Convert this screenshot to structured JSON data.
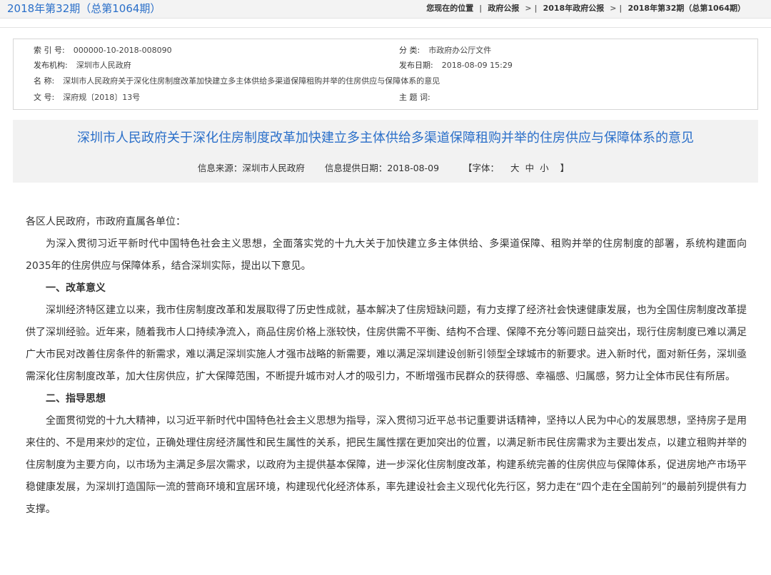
{
  "header": {
    "issue_title": "2018年第32期（总第1064期）",
    "breadcrumb_lead": "您现在的位置",
    "breadcrumb": [
      "政府公报",
      "2018年政府公报",
      "2018年第32期（总第1064期）"
    ],
    "separator": ">"
  },
  "meta": {
    "index_label": "索 引 号:",
    "index_value": "000000-10-2018-008090",
    "category_label": "分 类:",
    "category_value": "市政府办公厅文件",
    "publisher_label": "发布机构:",
    "publisher_value": "深圳市人民政府",
    "date_label": "发布日期:",
    "date_value": "2018-08-09 15:29",
    "name_label": "名 称:",
    "name_value": "深圳市人民政府关于深化住房制度改革加快建立多主体供给多渠道保障租购并举的住房供应与保障体系的意见",
    "docno_label": "文 号:",
    "docno_value": "深府规〔2018〕13号",
    "keywords_label": "主 题 词:",
    "keywords_value": ""
  },
  "document": {
    "title": "深圳市人民政府关于深化住房制度改革加快建立多主体供给多渠道保障租购并举的住房供应与保障体系的意见",
    "source": "信息来源：深圳市人民政府",
    "provided_date": "信息提供日期：2018-08-09",
    "font_open": "【字体：",
    "font_large": "大",
    "font_medium": "中",
    "font_small": "小",
    "font_close": "】"
  },
  "body": {
    "salutation": "各区人民政府，市政府直属各单位：",
    "intro": "为深入贯彻习近平新时代中国特色社会主义思想，全面落实党的十九大关于加快建立多主体供给、多渠道保障、租购并举的住房制度的部署，系统构建面向2035年的住房供应与保障体系，结合深圳实际，提出以下意见。",
    "heading1": "一、改革意义",
    "para1": "深圳经济特区建立以来，我市住房制度改革和发展取得了历史性成就，基本解决了住房短缺问题，有力支撑了经济社会快速健康发展，也为全国住房制度改革提供了深圳经验。近年来，随着我市人口持续净流入，商品住房价格上涨较快，住房供需不平衡、结构不合理、保障不充分等问题日益突出，现行住房制度已难以满足广大市民对改善住房条件的新需求，难以满足深圳实施人才强市战略的新需要，难以满足深圳建设创新引领型全球城市的新要求。进入新时代，面对新任务，深圳亟需深化住房制度改革，加大住房供应，扩大保障范围，不断提升城市对人才的吸引力，不断增强市民群众的获得感、幸福感、归属感，努力让全体市民住有所居。",
    "heading2": "二、指导思想",
    "para2": "全面贯彻党的十九大精神，以习近平新时代中国特色社会主义思想为指导，深入贯彻习近平总书记重要讲话精神，坚持以人民为中心的发展思想，坚持房子是用来住的、不是用来炒的定位，正确处理住房经济属性和民生属性的关系，把民生属性摆在更加突出的位置，以满足新市民住房需求为主要出发点，以建立租购并举的住房制度为主要方向，以市场为主满足多层次需求，以政府为主提供基本保障，进一步深化住房制度改革，构建系统完善的住房供应与保障体系，促进房地产市场平稳健康发展，为深圳打造国际一流的营商环境和宜居环境，构建现代化经济体系，率先建设社会主义现代化先行区，努力走在“四个走在全国前列”的最前列提供有力支撑。"
  }
}
